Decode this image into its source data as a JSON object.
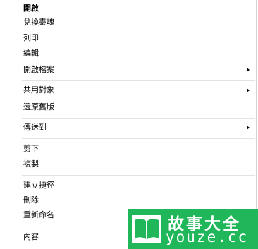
{
  "menu": {
    "open": "開啟",
    "change_soul": "兌換靈魂",
    "print": "列印",
    "edit": "編輯",
    "open_with": "開啟檔案",
    "share_with": "共用對象",
    "restore_previous": "還原舊版",
    "send_to": "傳送到",
    "cut": "剪下",
    "copy": "複製",
    "create_shortcut": "建立捷徑",
    "delete": "刪除",
    "rename": "重新命名",
    "properties": "內容"
  },
  "watermark": {
    "title": "故事大全",
    "url": "youze.cc",
    "color": "#20b65a",
    "icon": "open-book-icon"
  }
}
